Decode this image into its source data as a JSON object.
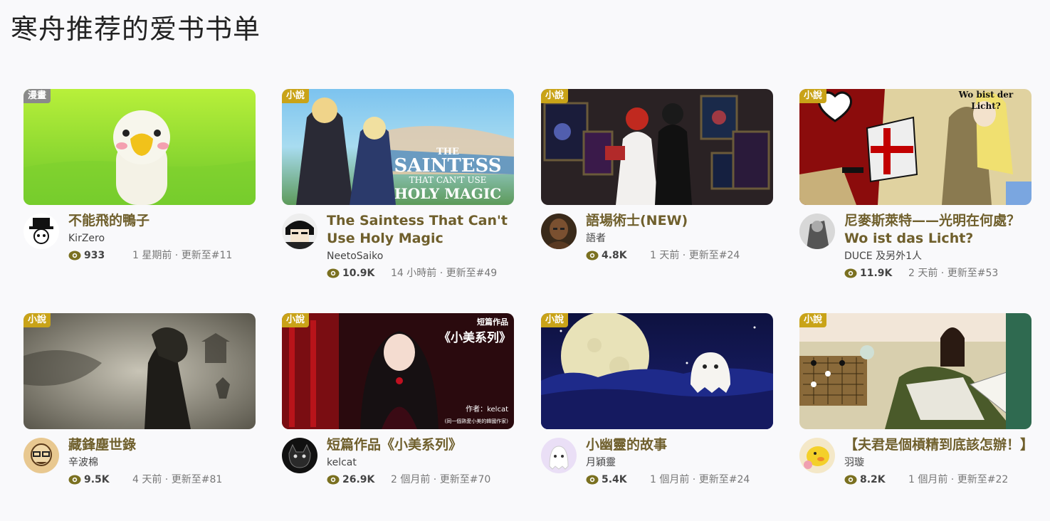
{
  "page": {
    "title": "寒舟推荐的爱书书单"
  },
  "colors": {
    "title_text": "#6f5f2c",
    "novel_badge": "#c9a318",
    "comic_badge": "#8a8a8a",
    "eye_icon": "#7a7020"
  },
  "cards": [
    {
      "badge": "漫畫",
      "badge_type": "comic",
      "title": "不能飛的鴨子",
      "author": "KirZero",
      "views": "933",
      "updated": "1 星期前 · 更新至#11"
    },
    {
      "badge": "小說",
      "badge_type": "novel",
      "title": "The Saintess That Can't Use Holy Magic",
      "author": "NeetoSaiko",
      "views": "10.9K",
      "updated": "14 小時前 · 更新至#49",
      "cover_text": {
        "line1": "THE",
        "line2": "SAINTESS",
        "line3": "THAT CAN'T USE",
        "line4": "HOLY MAGIC"
      }
    },
    {
      "badge": "小說",
      "badge_type": "novel",
      "title": "語場術士(NEW)",
      "author": "語者",
      "views": "4.8K",
      "updated": "1 天前 · 更新至#24"
    },
    {
      "badge": "小說",
      "badge_type": "novel",
      "title": "尼麥斯萊特——光明在何處？Wo ist das Licht?",
      "author": "DUCE 及另外1人",
      "views": "11.9K",
      "updated": "2 天前 · 更新至#53",
      "cover_text": {
        "line1": "Wo bist der",
        "line2": "Licht?"
      }
    },
    {
      "badge": "小說",
      "badge_type": "novel",
      "title": "藏鋒塵世錄",
      "author": "辛波棉",
      "views": "9.5K",
      "updated": "4 天前 · 更新至#81"
    },
    {
      "badge": "小說",
      "badge_type": "novel",
      "title": "短篇作品《小美系列》",
      "author": "kelcat",
      "views": "26.9K",
      "updated": "2 個月前 · 更新至#70",
      "cover_text": {
        "line1": "短篇作品",
        "line2": "《小美系列》",
        "line3": "作者：kelcat",
        "line4": "(同一個熟愛小美的韓國作家)"
      }
    },
    {
      "badge": "小說",
      "badge_type": "novel",
      "title": "小幽靈的故事",
      "author": "月穎靈",
      "views": "5.4K",
      "updated": "1 個月前 · 更新至#24"
    },
    {
      "badge": "小說",
      "badge_type": "novel",
      "title": "【夫君是個槓精到底該怎辦！】",
      "author": "羽璇",
      "views": "8.2K",
      "updated": "1 個月前 · 更新至#22"
    }
  ]
}
